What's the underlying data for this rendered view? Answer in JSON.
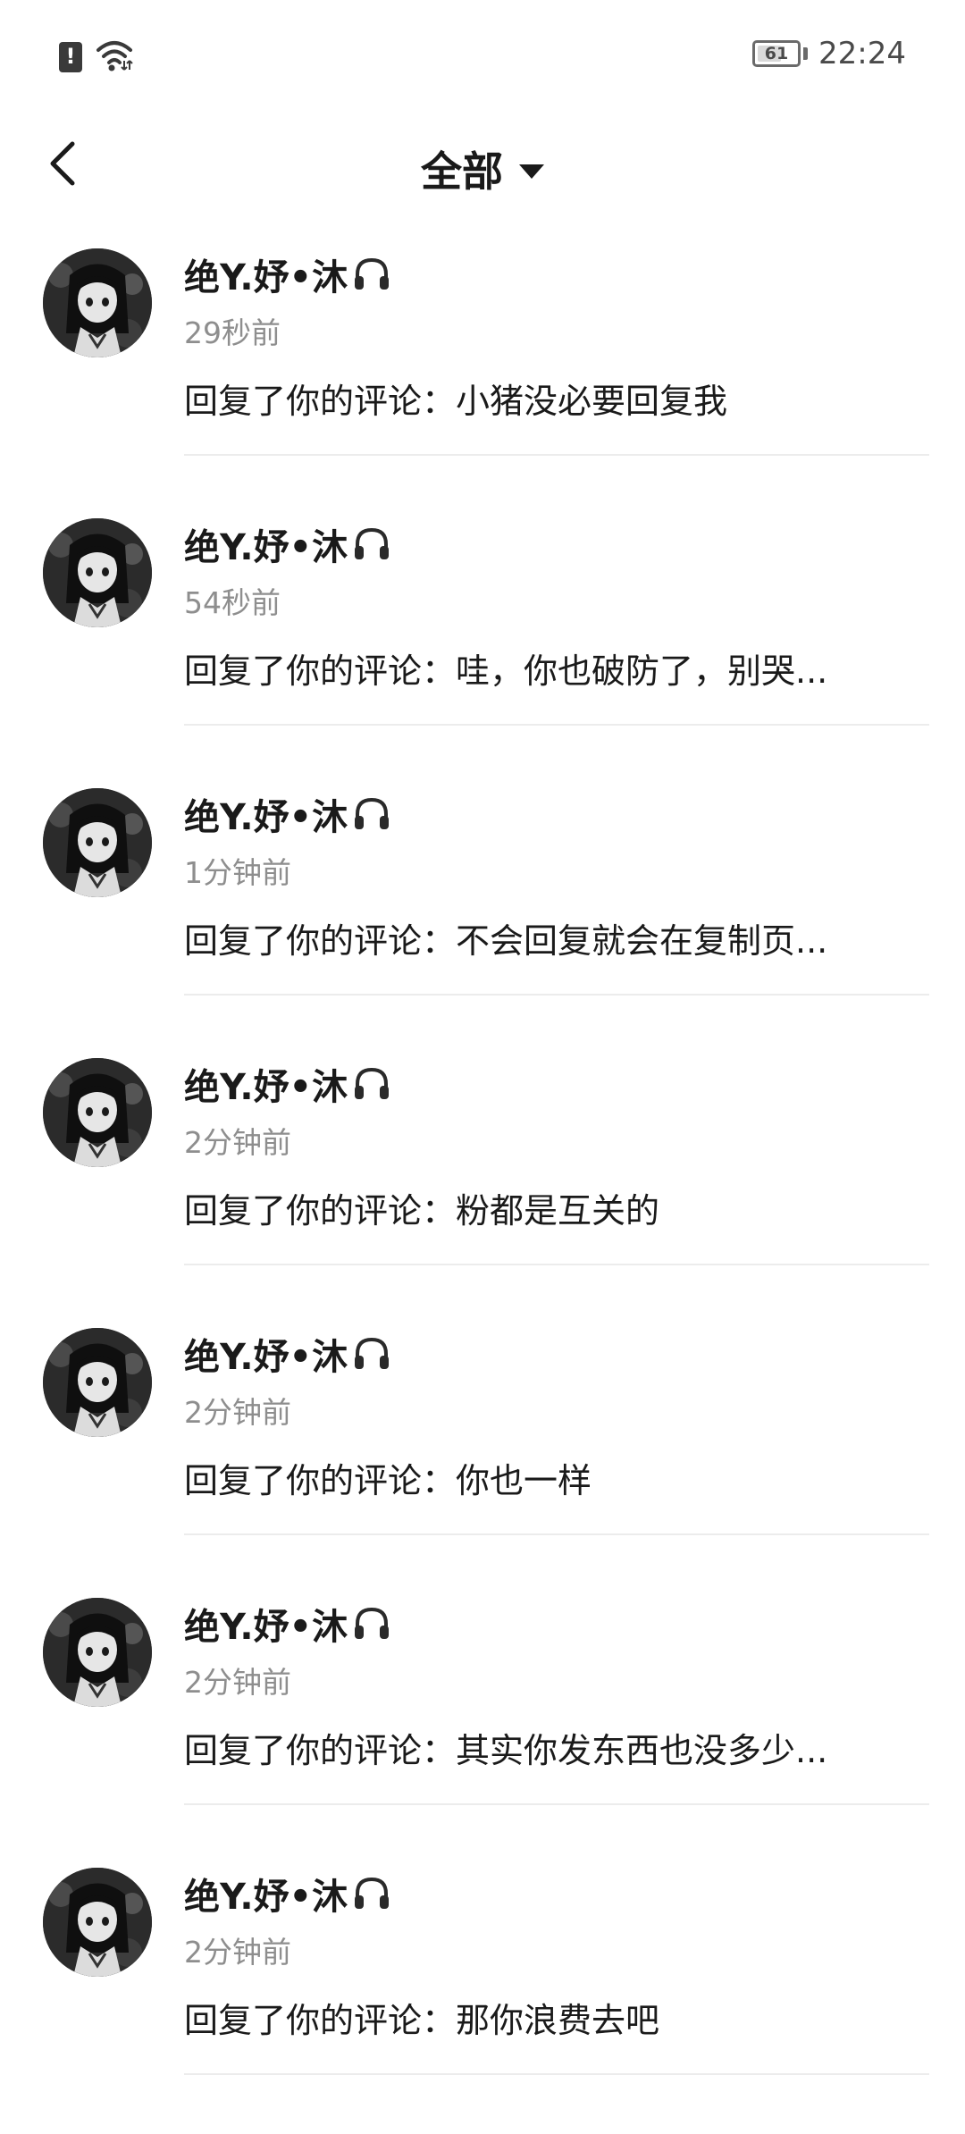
{
  "status_bar": {
    "battery_level": "61",
    "battery_fraction": 0.61,
    "time": "22:24",
    "icons": [
      "sim-alert-icon",
      "wifi-icon"
    ]
  },
  "header": {
    "title": "全部",
    "back_icon": "chevron-left-icon",
    "dropdown_icon": "caret-down-icon"
  },
  "notifications": [
    {
      "username": "绝Y.妤•沐",
      "badge_icon": "headphone-icon",
      "time": "29秒前",
      "message": "回复了你的评论：小猪没必要回复我"
    },
    {
      "username": "绝Y.妤•沐",
      "badge_icon": "headphone-icon",
      "time": "54秒前",
      "message": "回复了你的评论：哇，你也破防了，别哭..."
    },
    {
      "username": "绝Y.妤•沐",
      "badge_icon": "headphone-icon",
      "time": "1分钟前",
      "message": "回复了你的评论：不会回复就会在复制页..."
    },
    {
      "username": "绝Y.妤•沐",
      "badge_icon": "headphone-icon",
      "time": "2分钟前",
      "message": "回复了你的评论：粉都是互关的"
    },
    {
      "username": "绝Y.妤•沐",
      "badge_icon": "headphone-icon",
      "time": "2分钟前",
      "message": "回复了你的评论：你也一样"
    },
    {
      "username": "绝Y.妤•沐",
      "badge_icon": "headphone-icon",
      "time": "2分钟前",
      "message": "回复了你的评论：其实你发东西也没多少..."
    },
    {
      "username": "绝Y.妤•沐",
      "badge_icon": "headphone-icon",
      "time": "2分钟前",
      "message": "回复了你的评论：那你浪费去吧"
    }
  ],
  "colors": {
    "background": "#ffffff",
    "text_primary": "#1a1a1a",
    "text_secondary": "#8e8e8e",
    "divider": "#ececec"
  }
}
